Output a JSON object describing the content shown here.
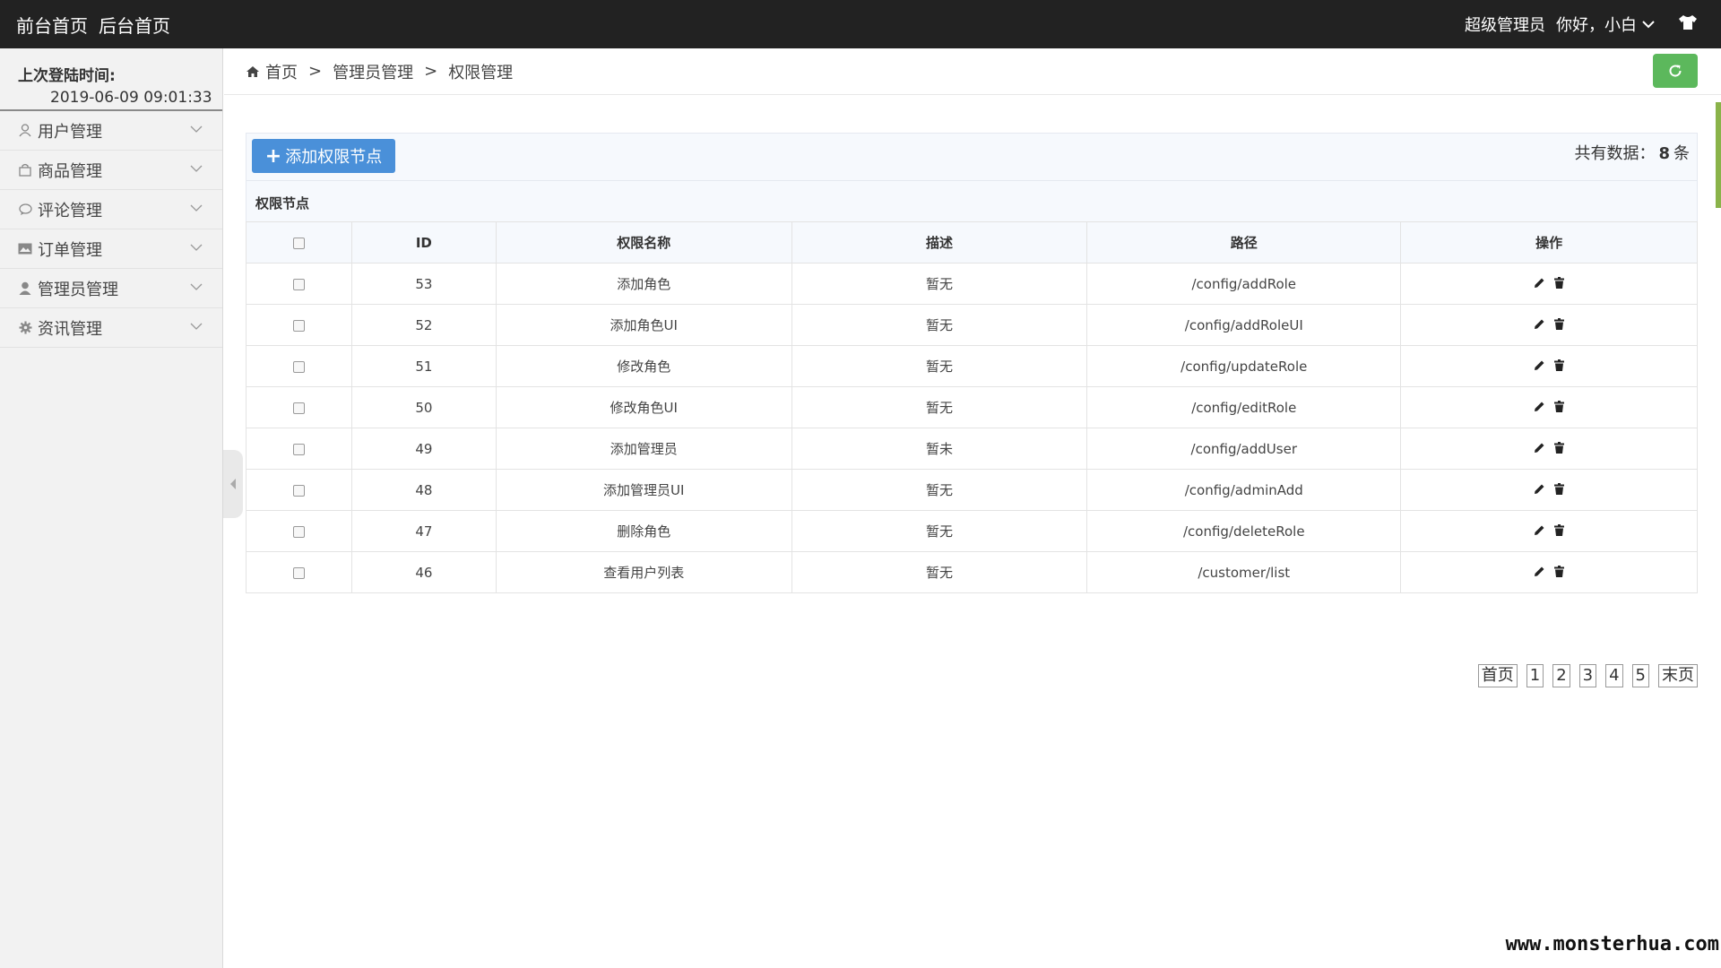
{
  "topbar": {
    "links": [
      "前台首页",
      "后台首页"
    ],
    "role": "超级管理员",
    "greeting": "你好，小白"
  },
  "sidebar": {
    "last_login_label": "上次登陆时间:",
    "last_login_value": "2019-06-09 09:01:33",
    "items": [
      {
        "label": "用户管理",
        "icon": "user-outline-icon"
      },
      {
        "label": "商品管理",
        "icon": "shopping-bag-icon"
      },
      {
        "label": "评论管理",
        "icon": "comment-icon"
      },
      {
        "label": "订单管理",
        "icon": "picture-card-icon"
      },
      {
        "label": "管理员管理",
        "icon": "user-solid-icon"
      },
      {
        "label": "资讯管理",
        "icon": "gear-icon"
      }
    ]
  },
  "breadcrumb": {
    "home": "首页",
    "level1": "管理员管理",
    "level2": "权限管理",
    "separator": ">"
  },
  "toolbar": {
    "add_button": "添加权限节点",
    "total_prefix": "共有数据：",
    "total_count": "8",
    "total_suffix": "条",
    "section_title": "权限节点"
  },
  "table": {
    "headers": [
      "ID",
      "权限名称",
      "描述",
      "路径",
      "操作"
    ],
    "rows": [
      {
        "id": "53",
        "name": "添加角色",
        "desc": "暂无",
        "path": "/config/addRole"
      },
      {
        "id": "52",
        "name": "添加角色UI",
        "desc": "暂无",
        "path": "/config/addRoleUI"
      },
      {
        "id": "51",
        "name": "修改角色",
        "desc": "暂无",
        "path": "/config/updateRole"
      },
      {
        "id": "50",
        "name": "修改角色UI",
        "desc": "暂无",
        "path": "/config/editRole"
      },
      {
        "id": "49",
        "name": "添加管理员",
        "desc": "暂未",
        "path": "/config/addUser"
      },
      {
        "id": "48",
        "name": "添加管理员UI",
        "desc": "暂无",
        "path": "/config/adminAdd"
      },
      {
        "id": "47",
        "name": "删除角色",
        "desc": "暂无",
        "path": "/config/deleteRole"
      },
      {
        "id": "46",
        "name": "查看用户列表",
        "desc": "暂无",
        "path": "/customer/list"
      }
    ]
  },
  "pager": [
    "首页",
    "1",
    "2",
    "3",
    "4",
    "5",
    "末页"
  ],
  "watermark": "www.monsterhua.com",
  "colors": {
    "topbar": "#222222",
    "primary_button": "#4a90d9",
    "refresh_button": "#5cb85c"
  }
}
